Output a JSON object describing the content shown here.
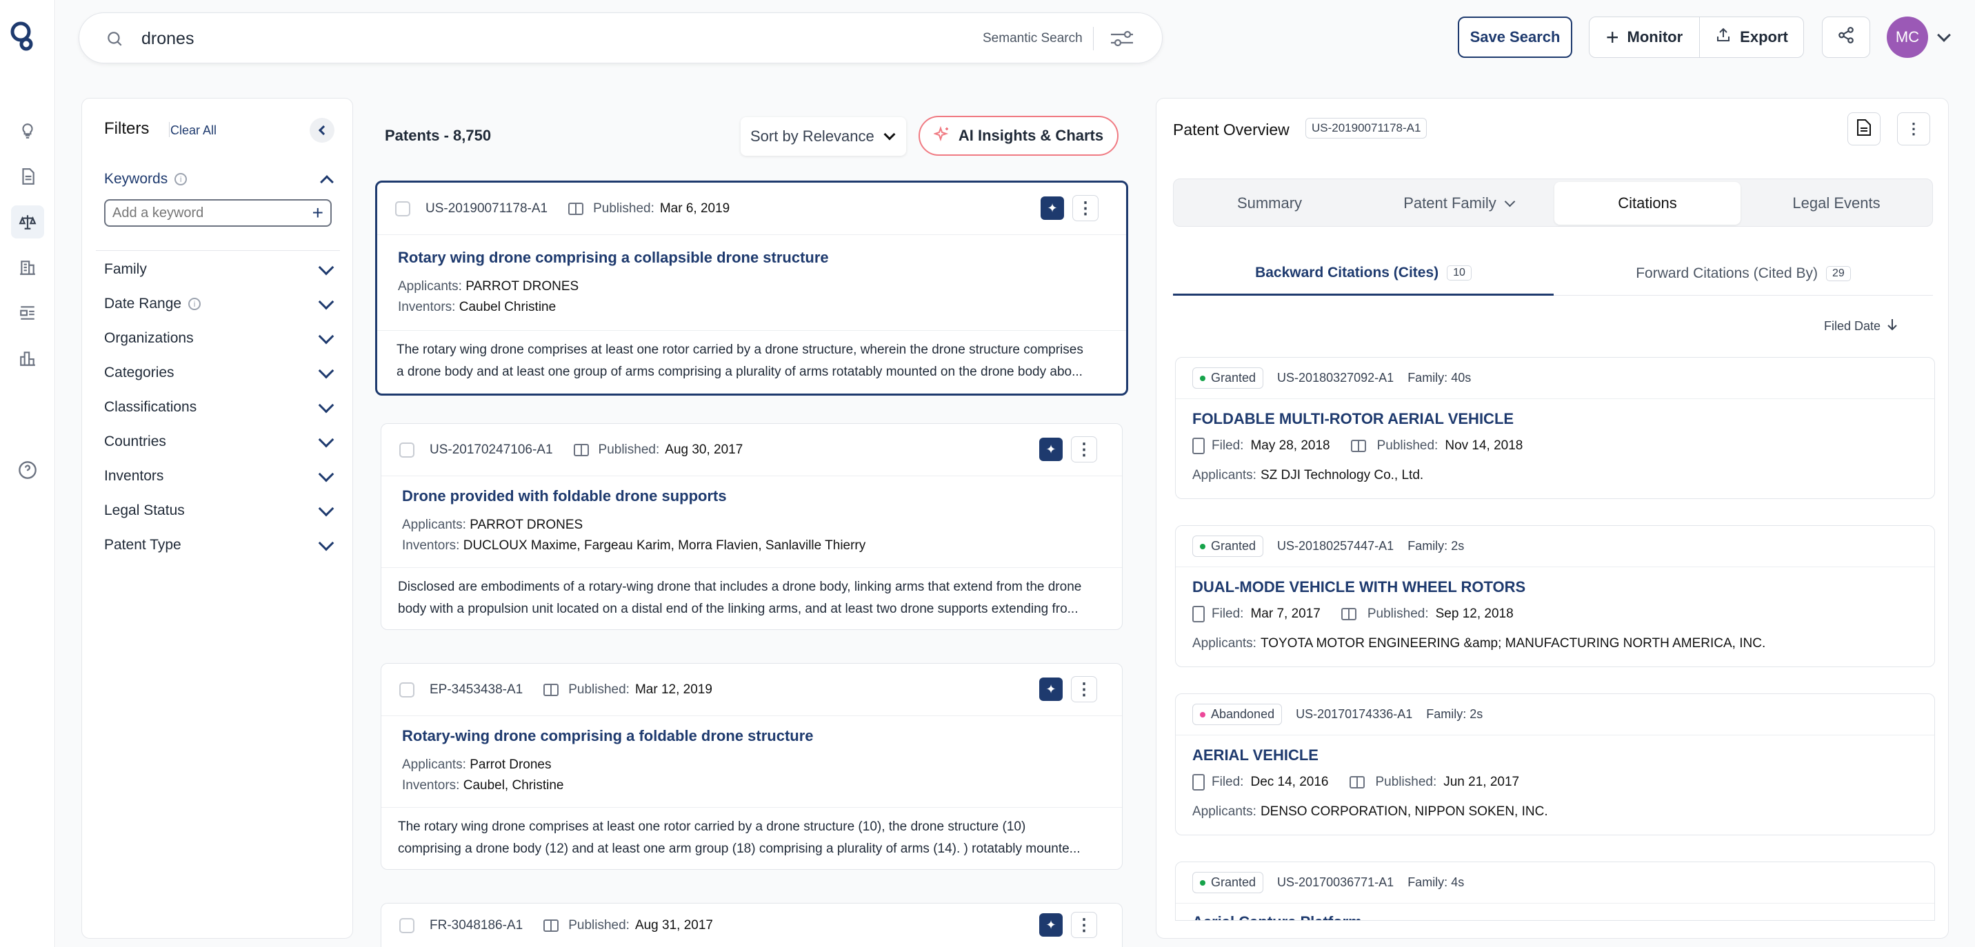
{
  "search": {
    "query": "drones",
    "mode": "Semantic Search"
  },
  "header": {
    "save_search": "Save Search",
    "monitor": "Monitor",
    "export": "Export",
    "avatar_initials": "MC"
  },
  "filters": {
    "title": "Filters",
    "clear_all": "Clear All",
    "keywords_label": "Keywords",
    "keyword_placeholder": "Add a keyword",
    "items": [
      "Family",
      "Date Range",
      "Organizations",
      "Categories",
      "Classifications",
      "Countries",
      "Inventors",
      "Legal Status",
      "Patent Type"
    ]
  },
  "results": {
    "count_label": "Patents - 8,750",
    "sort": "Sort by Relevance",
    "ai_insights": "AI Insights & Charts",
    "published_label": "Published:",
    "applicants_label": "Applicants:",
    "inventors_label": "Inventors:",
    "cards": [
      {
        "id": "US-20190071178-A1",
        "published": "Mar 6, 2019",
        "title": "Rotary wing drone comprising a collapsible drone structure",
        "applicants": "PARROT DRONES",
        "inventors": "Caubel Christine",
        "abstract_1": "The rotary wing drone comprises at least one rotor carried by a drone structure, wherein the drone structure comprises",
        "abstract_2": "a drone body and at least one group of arms comprising a plurality of arms rotatably mounted on the drone body abo..."
      },
      {
        "id": "US-20170247106-A1",
        "published": "Aug 30, 2017",
        "title": "Drone provided with foldable drone supports",
        "applicants": "PARROT DRONES",
        "inventors": "DUCLOUX Maxime, Fargeau Karim, Morra Flavien, Sanlaville Thierry",
        "abstract_1": "Disclosed are embodiments of a rotary-wing drone that includes a drone body, linking arms that extend from the drone",
        "abstract_2": "body with a propulsion unit located on a distal end of the linking arms, and at least two drone supports extending fro..."
      },
      {
        "id": "EP-3453438-A1",
        "published": "Mar 12, 2019",
        "title": "Rotary-wing drone comprising a foldable drone structure",
        "applicants": "Parrot Drones",
        "inventors": "Caubel, Christine",
        "abstract_1": "The rotary wing drone comprises at least one rotor carried by a drone structure (10), the drone structure (10)",
        "abstract_2": "comprising a drone body (12) and at least one arm group (18) comprising a plurality of arms (14). ) rotatably mounte..."
      },
      {
        "id": "FR-3048186-A1",
        "published": "Aug 31, 2017"
      }
    ]
  },
  "overview": {
    "title": "Patent Overview",
    "patent_id": "US-20190071178-A1",
    "tabs": [
      "Summary",
      "Patent Family",
      "Citations",
      "Legal Events"
    ],
    "backward_label": "Backward Citations (Cites)",
    "backward_count": "10",
    "forward_label": "Forward Citations (Cited By)",
    "forward_count": "29",
    "sort_label": "Filed Date",
    "filed_label": "Filed:",
    "published_label": "Published:",
    "applicants_label": "Applicants:",
    "citations": [
      {
        "status": "Granted",
        "status_color": "#16a34a",
        "id": "US-20180327092-A1",
        "family": "Family: 40s",
        "title": "FOLDABLE MULTI-ROTOR AERIAL VEHICLE",
        "filed": "May 28, 2018",
        "published": "Nov 14, 2018",
        "applicants": "SZ DJI Technology Co., Ltd."
      },
      {
        "status": "Granted",
        "status_color": "#16a34a",
        "id": "US-20180257447-A1",
        "family": "Family: 2s",
        "title": "DUAL-MODE VEHICLE WITH WHEEL ROTORS",
        "filed": "Mar 7, 2017",
        "published": "Sep 12, 2018",
        "applicants": "TOYOTA MOTOR ENGINEERING &amp; MANUFACTURING NORTH AMERICA, INC."
      },
      {
        "status": "Abandoned",
        "status_color": "#ec4899",
        "id": "US-20170174336-A1",
        "family": "Family: 2s",
        "title": "AERIAL VEHICLE",
        "filed": "Dec 14, 2016",
        "published": "Jun 21, 2017",
        "applicants": "DENSO CORPORATION, NIPPON SOKEN, INC."
      },
      {
        "status": "Granted",
        "status_color": "#16a34a",
        "id": "US-20170036771-A1",
        "family": "Family: 4s",
        "title": "Aerial Capture Platform"
      }
    ]
  }
}
